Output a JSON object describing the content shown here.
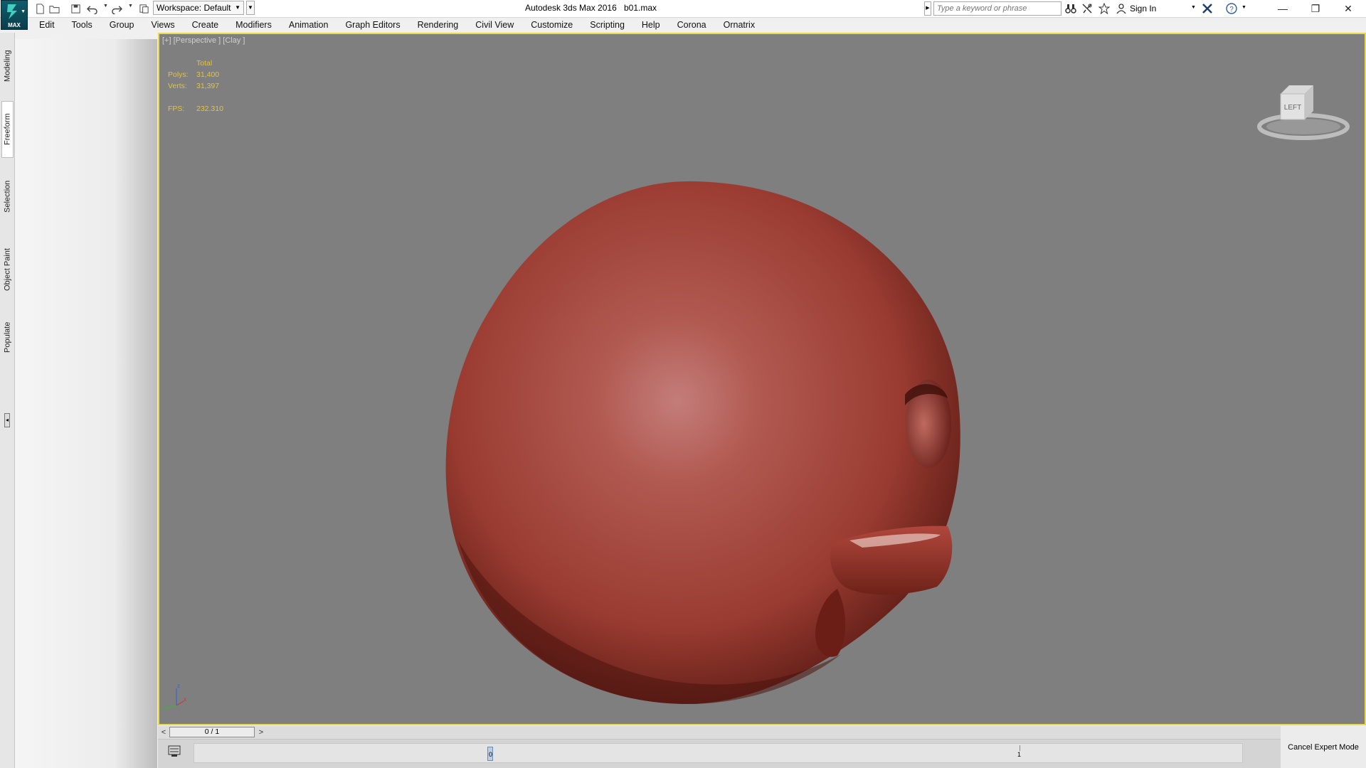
{
  "titlebar": {
    "app_title": "Autodesk 3ds Max 2016",
    "file_name": "b01.max",
    "logo_label": "MAX",
    "workspace_label": "Workspace: Default",
    "search_placeholder": "Type a keyword or phrase",
    "sign_in_label": "Sign In"
  },
  "menu": {
    "items": [
      "Edit",
      "Tools",
      "Group",
      "Views",
      "Create",
      "Modifiers",
      "Animation",
      "Graph Editors",
      "Rendering",
      "Civil View",
      "Customize",
      "Scripting",
      "Help",
      "Corona",
      "Ornatrix"
    ]
  },
  "left_tabs": {
    "items": [
      "Modeling",
      "Freeform",
      "Selection",
      "Object Paint",
      "Populate"
    ],
    "active": "Freeform"
  },
  "viewport": {
    "label": "[+] [Perspective ] [Clay ]",
    "stats": {
      "header": "Total",
      "polys_label": "Polys:",
      "polys_value": "31,400",
      "verts_label": "Verts:",
      "verts_value": "31,397",
      "fps_label": "FPS:",
      "fps_value": "232.310"
    },
    "viewcube_face": "LEFT",
    "colors": {
      "background": "#7f7f7f",
      "border_active": "#e8d84a",
      "stats_text": "#e6c430",
      "model_clay": "#a8453b"
    }
  },
  "timeline": {
    "frame_display": "0 / 1",
    "key_label": "0",
    "end_tick_label": "1",
    "prev_label": "<",
    "next_label": ">"
  },
  "status": {
    "cancel_expert_label": "Cancel Expert Mode"
  }
}
